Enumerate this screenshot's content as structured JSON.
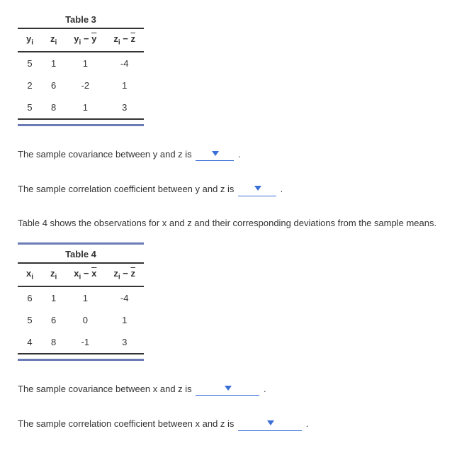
{
  "table3": {
    "title": "Table 3",
    "headers": {
      "c1": "y",
      "c1sub": "i",
      "c2": "z",
      "c2sub": "i",
      "c3a": "y",
      "c3sub": "i",
      "c3b": " − ",
      "c3c": "y",
      "c4a": "z",
      "c4sub": "i",
      "c4b": " − ",
      "c4c": "z"
    },
    "rows": [
      {
        "y": "5",
        "z": "1",
        "yd": "1",
        "zd": "-4"
      },
      {
        "y": "2",
        "z": "6",
        "yd": "-2",
        "zd": "1"
      },
      {
        "y": "5",
        "z": "8",
        "yd": "1",
        "zd": "3"
      }
    ]
  },
  "statements": {
    "s1": "The sample covariance between y and z is ",
    "s2": "The sample correlation coefficient between y and z is ",
    "s3": "Table 4 shows the observations for x and z and their corresponding deviations from the sample means.",
    "s4": "The sample covariance between x and z is ",
    "s5": "The sample correlation coefficient between x and z is ",
    "period": "."
  },
  "table4": {
    "title": "Table 4",
    "headers": {
      "c1": "x",
      "c1sub": "i",
      "c2": "z",
      "c2sub": "i",
      "c3a": "x",
      "c3sub": "i",
      "c3b": " − ",
      "c3c": "x",
      "c4a": "z",
      "c4sub": "i",
      "c4b": " − ",
      "c4c": "z"
    },
    "rows": [
      {
        "x": "6",
        "z": "1",
        "xd": "1",
        "zd": "-4"
      },
      {
        "x": "5",
        "z": "6",
        "xd": "0",
        "zd": "1"
      },
      {
        "x": "4",
        "z": "8",
        "xd": "-1",
        "zd": "3"
      }
    ]
  }
}
